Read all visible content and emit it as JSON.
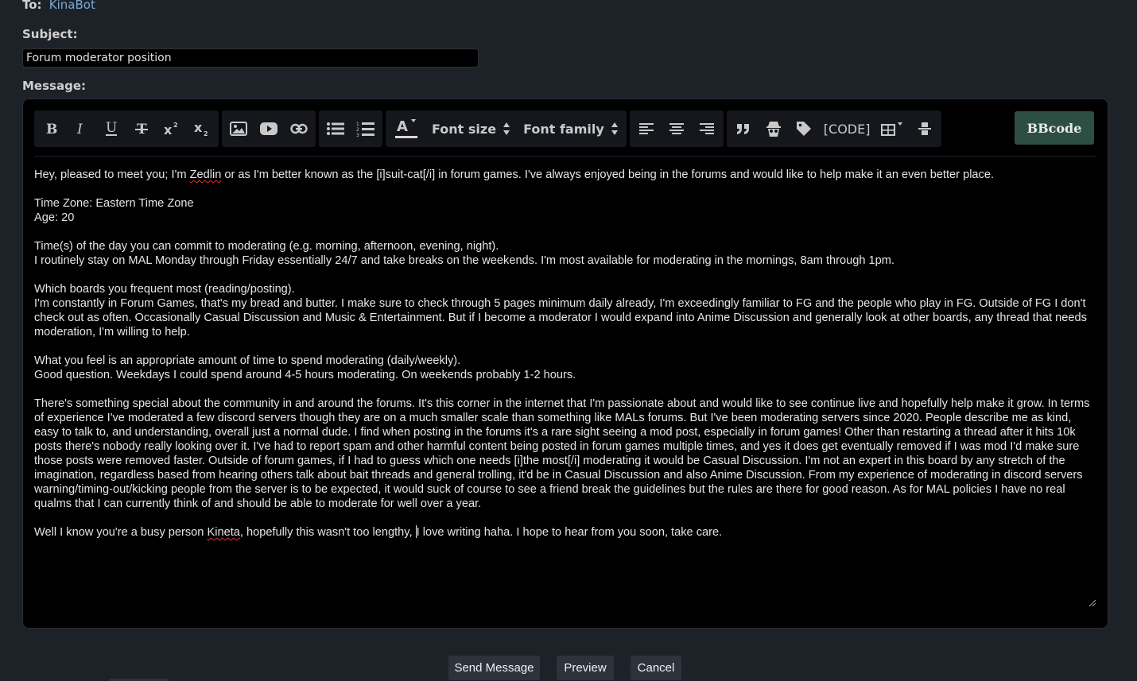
{
  "header": {
    "to_label": "To:",
    "to_name": "KinaBot",
    "subject_label": "Subject:",
    "subject_value": "Forum moderator position",
    "message_label": "Message:"
  },
  "toolbar": {
    "font_size_label": "Font size",
    "font_family_label": "Font family",
    "code_label": "[CODE]",
    "bbcode_label": "BBcode",
    "icons": [
      "bold-icon",
      "italic-icon",
      "underline-icon",
      "strikethrough-icon",
      "superscript-icon",
      "subscript-icon",
      "image-icon",
      "youtube-icon",
      "link-icon",
      "bulleted-list-icon",
      "numbered-list-icon",
      "font-color-icon",
      "align-left-icon",
      "align-center-icon",
      "align-right-icon",
      "quote-icon",
      "spoiler-icon",
      "tag-icon",
      "table-icon",
      "separator-icon"
    ]
  },
  "message": {
    "p1a": "Hey, pleased to meet you; I'm ",
    "p1_name": "Zedlin",
    "p1b": " or as I'm better known as the [i]suit-cat[/i] in forum games. I've always enjoyed being in the forums and would like to help make it an even better place.",
    "p2": "Time Zone: Eastern Time Zone\nAge: 20",
    "p3": "Time(s) of the day you can commit to moderating (e.g. morning, afternoon, evening, night).\nI routinely stay on MAL Monday through Friday essentially 24/7 and take breaks on the weekends. I'm most available for moderating in the mornings, 8am through 1pm.",
    "p4": "Which boards you frequent most (reading/posting).\nI'm constantly in Forum Games, that's my bread and butter. I make sure to check through 5 pages minimum daily already, I'm exceedingly familiar to FG and the people who play in FG. Outside of FG I don't check out as often. Occasionally Casual Discussion and Music & Entertainment. But if I become a moderator I would expand into Anime Discussion and generally look at other boards, any thread that needs moderation, I'm willing to help.",
    "p5": "What you feel is an appropriate amount of time to spend moderating (daily/weekly).\nGood question. Weekdays I could spend around 4-5 hours moderating. On weekends probably 1-2 hours.",
    "p6": "There's something special about the community in and around the forums. It's this corner in the internet that I'm passionate about and would like to see continue live and hopefully help make it grow. In terms of experience I've moderated a few discord servers though they are on a much smaller scale than something like MALs forums. But I've been moderating servers since 2020. People describe me as kind, easy to talk to, and understanding, overall just a normal dude. I find when posting in the forums it's a rare sight seeing a mod post, especially in forum games! Other than restarting a thread after it hits 10k posts there's nobody really looking over it. I've had to report spam and other harmful content being posted in forum games multiple times, and yes it does get eventually removed if I was mod I'd make sure those posts were removed faster. Outside of forum games, if I had to guess which one needs [i]the most[/i] moderating it would be Casual Discussion. I'm not an expert in this board by any stretch of the imagination, regardless based from hearing others talk about bait threads and general trolling, it'd be in Casual Discussion and also Anime Discussion. From my experience of moderating in discord servers warning/timing-out/kicking people from the server is to be expected, it would suck of course to see a friend break the guidelines but the rules are there for good reason. As for MAL policies I have no real qualms that I can currently think of and should be able to moderate for well over a year.",
    "p7a": "Well I know you're a busy person ",
    "p7_name": "Kineta",
    "p7b": ", hopefully this wasn't too lengthy, ",
    "p7c": "I love writing haha. I hope to hear from you soon, take care."
  },
  "buttons": {
    "send": "Send Message",
    "preview": "Preview",
    "cancel": "Cancel"
  }
}
